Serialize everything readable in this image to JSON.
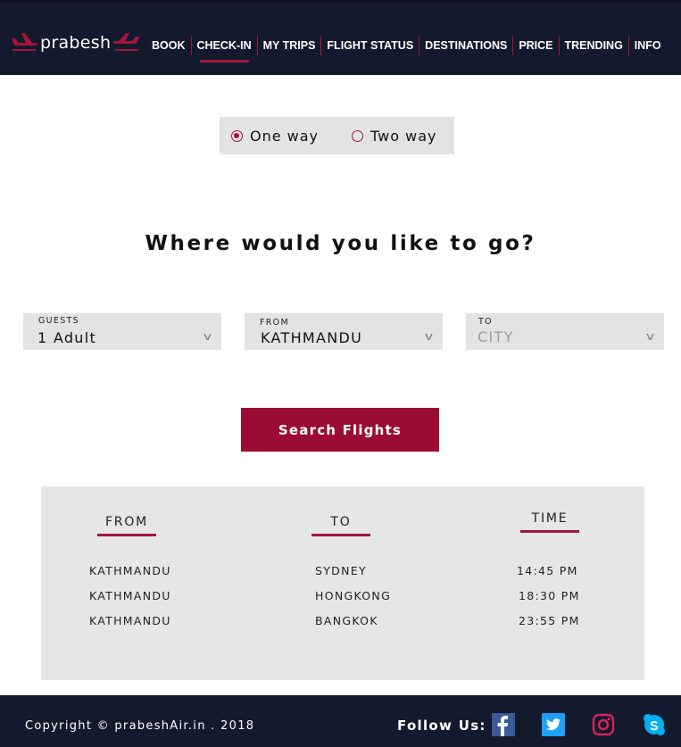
{
  "brand": {
    "name": "prabesh",
    "accent": "#a3163a",
    "nav_bg": "#141a2e"
  },
  "nav": {
    "items": [
      {
        "label": "BOOK",
        "active": false
      },
      {
        "label": "CHECK-IN",
        "active": true
      },
      {
        "label": "MY TRIPS",
        "active": false
      },
      {
        "label": "FLIGHT STATUS",
        "active": false
      },
      {
        "label": "DESTINATIONS",
        "active": false
      },
      {
        "label": "PRICE",
        "active": false
      },
      {
        "label": "TRENDING",
        "active": false
      },
      {
        "label": "INFO",
        "active": false
      }
    ]
  },
  "trip_type": {
    "options": [
      {
        "label": "One way",
        "selected": true
      },
      {
        "label": "Two way",
        "selected": false
      }
    ]
  },
  "headline": "Where would you like to go?",
  "form": {
    "guests": {
      "label": "GUESTS",
      "value": "1 Adult"
    },
    "from": {
      "label": "FROM",
      "value": "KATHMANDU"
    },
    "to": {
      "label": "TO",
      "placeholder": "CITY"
    },
    "chevron": "v",
    "search_label": "Search Flights"
  },
  "schedule": {
    "headers": [
      "FROM",
      "TO",
      "TIME"
    ],
    "rows": [
      [
        "KATHMANDU",
        "SYDNEY",
        "14:45 PM"
      ],
      [
        "KATHMANDU",
        "HONGKONG",
        "18:30 PM"
      ],
      [
        "KATHMANDU",
        "BANGKOK",
        "23:55 PM"
      ]
    ]
  },
  "footer": {
    "copyright": "Copyright © prabeshAir.in . 2018",
    "follow_label": "Follow Us:",
    "social": [
      {
        "icon": "facebook-icon",
        "color": "#3b5998"
      },
      {
        "icon": "twitter-icon",
        "color": "#1da1f2"
      },
      {
        "icon": "instagram-icon",
        "color": "#d6245f"
      },
      {
        "icon": "skype-icon",
        "color": "#00aff0"
      }
    ]
  }
}
